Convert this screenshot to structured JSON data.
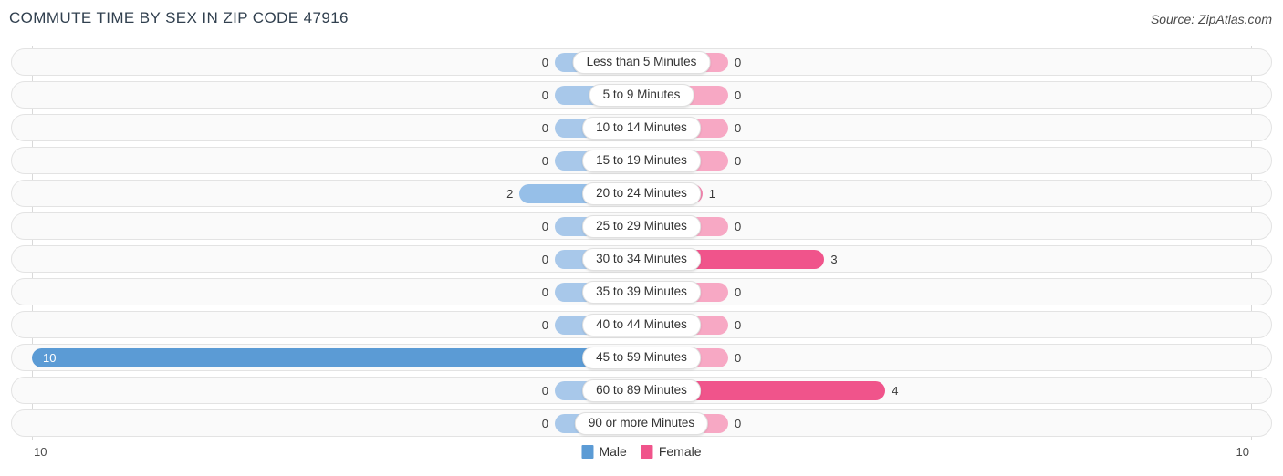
{
  "title": "COMMUTE TIME BY SEX IN ZIP CODE 47916",
  "source": "Source: ZipAtlas.com",
  "axis": {
    "left_tick": "10",
    "right_tick": "10"
  },
  "legend": {
    "male": {
      "label": "Male",
      "color": "#5b9bd5"
    },
    "female": {
      "label": "Female",
      "color": "#f0548b"
    }
  },
  "chart_data": {
    "type": "bar",
    "title": "COMMUTE TIME BY SEX IN ZIP CODE 47916",
    "subtitle": "Source: ZipAtlas.com",
    "orientation": "horizontal-diverging",
    "xlabel": "",
    "ylabel": "",
    "xlim": [
      -10,
      10
    ],
    "grid": false,
    "legend_position": "bottom-center",
    "categories": [
      "Less than 5 Minutes",
      "5 to 9 Minutes",
      "10 to 14 Minutes",
      "15 to 19 Minutes",
      "20 to 24 Minutes",
      "25 to 29 Minutes",
      "30 to 34 Minutes",
      "35 to 39 Minutes",
      "40 to 44 Minutes",
      "45 to 59 Minutes",
      "60 to 89 Minutes",
      "90 or more Minutes"
    ],
    "series": [
      {
        "name": "Male",
        "direction": "left",
        "color": "#5b9bd5",
        "values": [
          0,
          0,
          0,
          0,
          2,
          0,
          0,
          0,
          0,
          10,
          0,
          0
        ]
      },
      {
        "name": "Female",
        "direction": "right",
        "color": "#f0548b",
        "values": [
          0,
          0,
          0,
          0,
          1,
          0,
          3,
          0,
          0,
          0,
          4,
          0
        ]
      }
    ],
    "value_labels": {
      "male": [
        "0",
        "0",
        "0",
        "0",
        "2",
        "0",
        "0",
        "0",
        "0",
        "10",
        "0",
        "0"
      ],
      "female": [
        "0",
        "0",
        "0",
        "0",
        "1",
        "0",
        "3",
        "0",
        "0",
        "0",
        "4",
        "0"
      ]
    }
  }
}
